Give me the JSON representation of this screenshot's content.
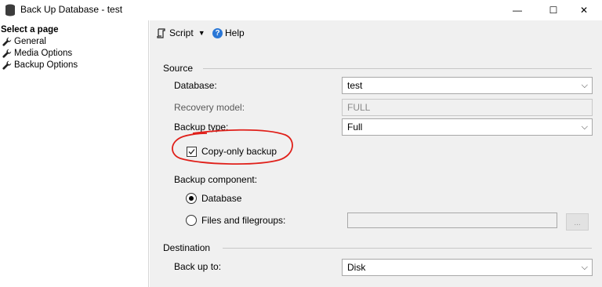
{
  "window": {
    "title": "Back Up Database - test",
    "minimize_glyph": "—",
    "maximize_glyph": "☐",
    "close_glyph": "✕"
  },
  "left_panel": {
    "header": "Select a page",
    "items": [
      {
        "label": "General",
        "icon": "wrench-icon"
      },
      {
        "label": "Media Options",
        "icon": "wrench-icon"
      },
      {
        "label": "Backup Options",
        "icon": "wrench-icon"
      }
    ]
  },
  "toolbar": {
    "script_label": "Script",
    "help_label": "Help"
  },
  "source": {
    "group_title": "Source",
    "database_label": "Database:",
    "database_value": "test",
    "recovery_label": "Recovery model:",
    "recovery_value": "FULL",
    "backup_type_label": "Backup type:",
    "backup_type_value": "Full",
    "copy_only_label": "Copy-only backup",
    "copy_only_checked": true,
    "component_label": "Backup component:",
    "component_options": [
      {
        "label": "Database",
        "checked": true
      },
      {
        "label": "Files and filegroups:",
        "checked": false
      }
    ],
    "browse_label": "..."
  },
  "destination": {
    "group_title": "Destination",
    "back_up_to_label": "Back up to:",
    "back_up_to_value": "Disk"
  },
  "colors": {
    "annotation_red": "#e0201a",
    "help_blue": "#2a77d6",
    "panel_bg": "#f0f0f0"
  }
}
